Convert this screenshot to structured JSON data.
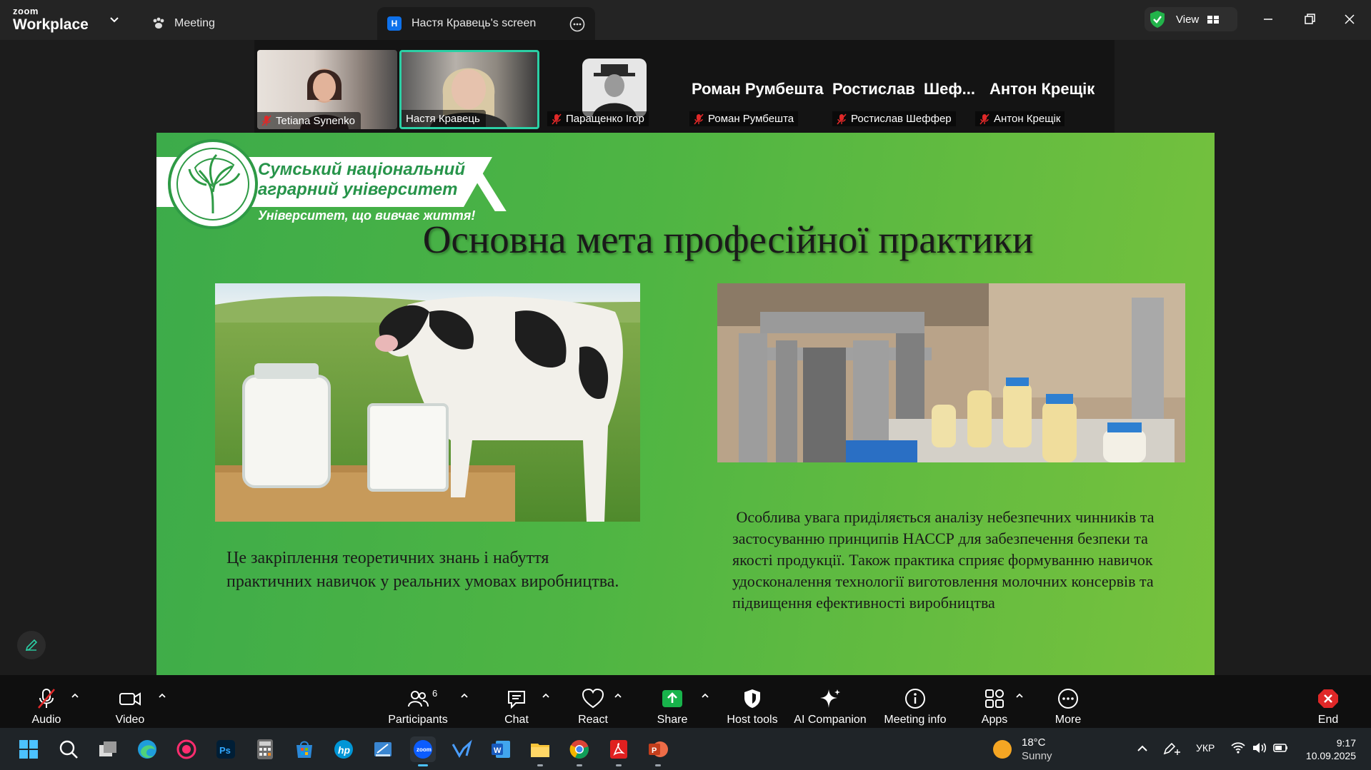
{
  "app": {
    "logo_small": "zoom",
    "logo_big": "Workplace"
  },
  "tabs": {
    "meeting": "Meeting",
    "screen": "Настя Кравець's screen",
    "screen_badge": "H"
  },
  "view_label": "View",
  "participants": [
    {
      "name": "Tetiana Synenko",
      "muted": true
    },
    {
      "name": "Настя Кравець",
      "muted": false,
      "active_speaker": true
    },
    {
      "name": "Паращенко Ігор",
      "muted": true
    },
    {
      "name": "Роман Румбешта",
      "muted": true,
      "big_label": "Роман Румбешта"
    },
    {
      "name": "Ростислав Шеффер",
      "muted": true,
      "big_label": "Ростислав  Шеф..."
    },
    {
      "name": "Антон Крещік",
      "muted": true,
      "big_label": "Антон Крещік"
    }
  ],
  "slide": {
    "uni_line1": "Сумський національний",
    "uni_line2": "аграрний університет",
    "uni_motto": "Університет, що вивчає життя!",
    "title": "Основна мета професійної практики",
    "left_text": "Це закріплення теоретичних знань і набуття практичних навичок у реальних умовах виробництва.",
    "right_text": " Особлива увага приділяється аналізу небезпечних чинників та застосуванню принципів НАССР для забезпечення безпеки та якості продукції. Також практика сприяє формуванню навичок удосконалення технології виготовлення молочних консервів та підвищення ефективності виробництва",
    "bg_color": "#4fb543"
  },
  "toolbar": {
    "audio": "Audio",
    "video": "Video",
    "participants": "Participants",
    "participants_count": "6",
    "chat": "Chat",
    "react": "React",
    "share": "Share",
    "host_tools": "Host tools",
    "ai_companion": "AI Companion",
    "meeting_info": "Meeting info",
    "apps": "Apps",
    "more": "More",
    "end": "End"
  },
  "taskbar": {
    "weather_temp": "18°C",
    "weather_desc": "Sunny",
    "language": "УКР",
    "time": "9:17",
    "date": "10.09.2025"
  },
  "colors": {
    "accent_green": "#2bd0a5",
    "share_green": "#18b34b",
    "end_red": "#e02828",
    "zoom_blue": "#0e71eb"
  }
}
